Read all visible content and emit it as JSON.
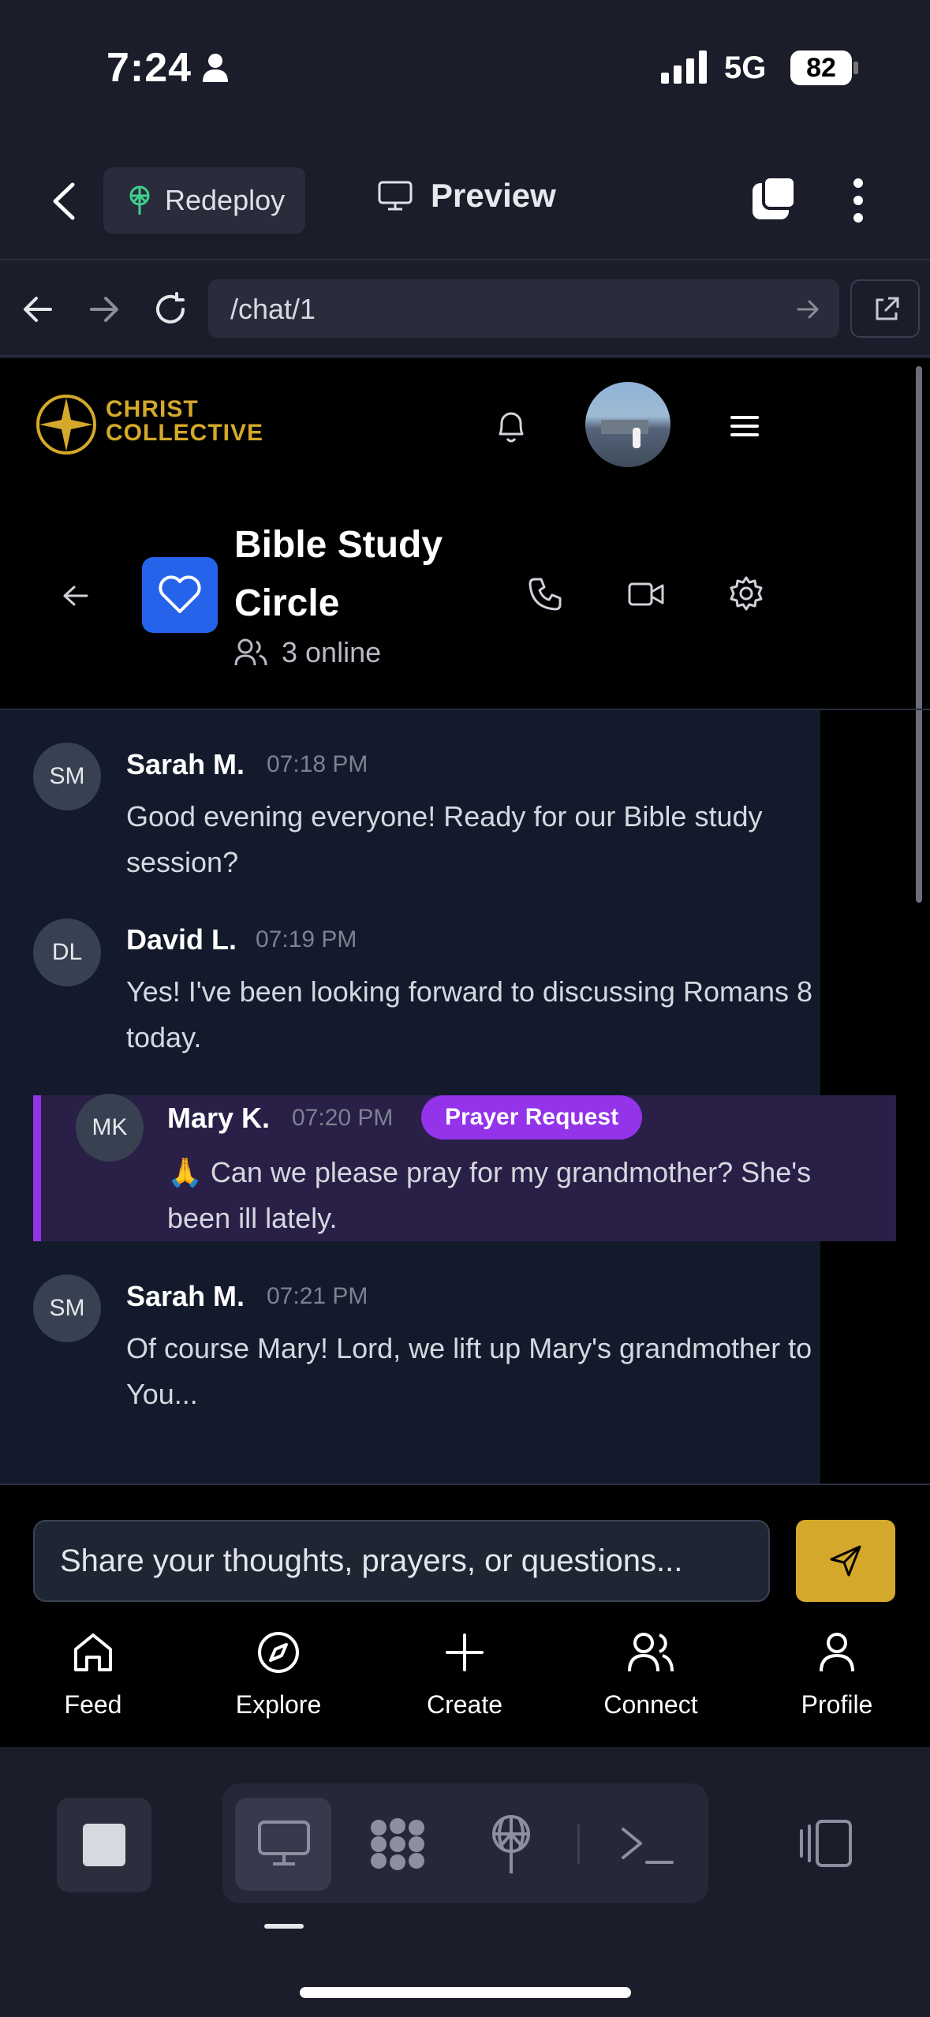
{
  "status_bar": {
    "time": "7:24",
    "network": "5G",
    "battery": "82"
  },
  "editor_header": {
    "redeploy_label": "Redeploy",
    "preview_label": "Preview"
  },
  "url_bar": {
    "path": "/chat/1"
  },
  "app": {
    "logo_line1": "CHRIST",
    "logo_line2": "COLLECTIVE",
    "brand_color": "#d4a82a"
  },
  "chat": {
    "group_name_line1": "Bible Study",
    "group_name_line2": "Circle",
    "online": "3 online",
    "messages": [
      {
        "initials": "SM",
        "name": "Sarah M.",
        "time": "07:18 PM",
        "text": "Good evening everyone! Ready for our Bible study session?"
      },
      {
        "initials": "DL",
        "name": "David L.",
        "time": "07:19 PM",
        "text": "Yes! I've been looking forward to discussing Romans 8 today."
      },
      {
        "initials": "MK",
        "name": "Mary K.",
        "time": "07:20 PM",
        "badge": "Prayer Request",
        "text": "🙏 Can we please pray for my grandmother? She's been ill lately."
      },
      {
        "initials": "SM",
        "name": "Sarah M.",
        "time": "07:21 PM",
        "text": "Of course Mary! Lord, we lift up Mary's grandmother to You..."
      }
    ],
    "input_placeholder": "Share your thoughts, prayers, or questions..."
  },
  "bottom_nav": [
    "Feed",
    "Explore",
    "Create",
    "Connect",
    "Profile"
  ]
}
